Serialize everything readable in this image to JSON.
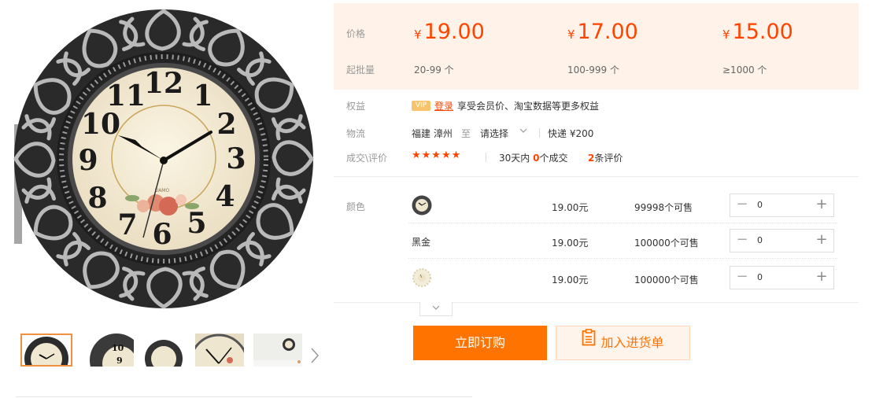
{
  "gallery": {
    "main_image": "wall-clock-black-silver-ornate-frame",
    "thumbnails": [
      "clock-front",
      "clock-closeup",
      "clock-front-small",
      "clock-face-detail",
      "clock-small-side"
    ],
    "next_icon": "chevron-right-icon",
    "clock_face": {
      "numbers": [
        "12",
        "1",
        "2",
        "3",
        "4",
        "5",
        "6",
        "7",
        "8",
        "9",
        "10",
        "11"
      ],
      "brand": "UAMO"
    }
  },
  "price": {
    "label": "价格",
    "currency": "¥",
    "tiers": [
      "19.00",
      "17.00",
      "15.00"
    ]
  },
  "moq": {
    "label": "起批量",
    "tiers": [
      "20-99 个",
      "100-999 个",
      "≥1000 个"
    ]
  },
  "benefits": {
    "label": "权益",
    "badge": "VIP",
    "login": "登录",
    "text": "享受会员价、淘宝数据等更多权益"
  },
  "logistics": {
    "label": "物流",
    "origin": "福建 漳州",
    "to": "至",
    "destination": "请选择",
    "dropdown_icon": "chevron-down-icon",
    "shipping": "快递 ¥200"
  },
  "reviews": {
    "label": "成交\\评价",
    "stars": "★★★★★",
    "sales_prefix": "30天内",
    "sales_count": "0",
    "sales_suffix": "个成交",
    "review_count": "2",
    "review_suffix": "条评价"
  },
  "sku": {
    "label": "颜色",
    "rows": [
      {
        "name": "",
        "image": "clock-black-thumb",
        "price": "19.00元",
        "stock": "99998个可售",
        "qty": "0"
      },
      {
        "name": "黑金",
        "image": "",
        "price": "19.00元",
        "stock": "100000个可售",
        "qty": "0"
      },
      {
        "name": "",
        "image": "clock-light-thumb",
        "price": "19.00元",
        "stock": "100000个可售",
        "qty": "0"
      }
    ],
    "minus": "−",
    "plus": "+",
    "expand_icon": "chevron-down-icon"
  },
  "actions": {
    "order": "立即订购",
    "cart": "加入进货单",
    "cart_icon": "clipboard-icon"
  },
  "colors": {
    "accent": "#ff4400",
    "button_orange": "#ff7300",
    "price_bg": "#fff2e8"
  }
}
